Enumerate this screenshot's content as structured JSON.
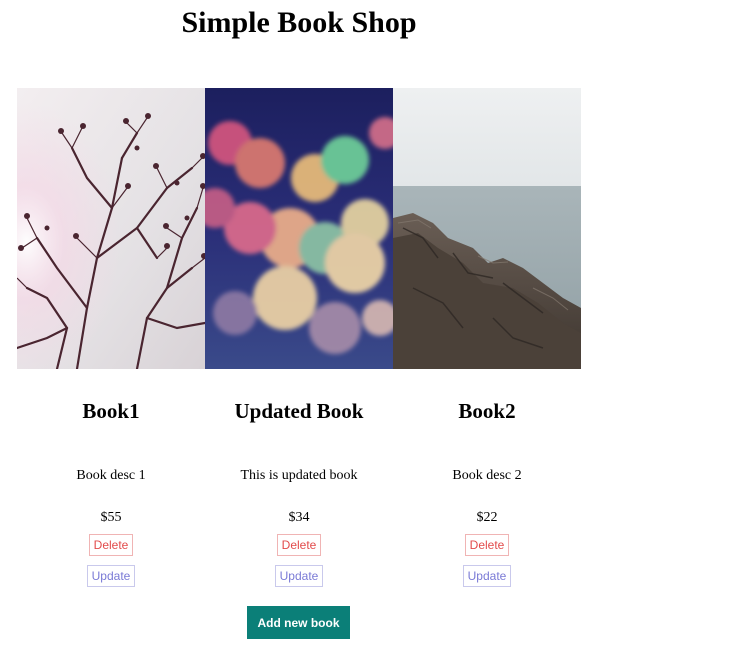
{
  "header": {
    "title": "Simple Book Shop"
  },
  "books": [
    {
      "title": "Book1",
      "description": "Book desc 1",
      "price": "$55",
      "delete_label": "Delete",
      "update_label": "Update",
      "cover": "branches-photo"
    },
    {
      "title": "Updated Book",
      "description": "This is updated book",
      "price": "$34",
      "delete_label": "Delete",
      "update_label": "Update",
      "cover": "bokeh-lights-photo"
    },
    {
      "title": "Book2",
      "description": "Book desc 2",
      "price": "$22",
      "delete_label": "Delete",
      "update_label": "Update",
      "cover": "rocky-sea-photo"
    }
  ],
  "actions": {
    "add_label": "Add new book"
  },
  "colors": {
    "add_button": "#0b7f78",
    "delete_text": "#e24b4b",
    "update_text": "#7a7ad6"
  }
}
